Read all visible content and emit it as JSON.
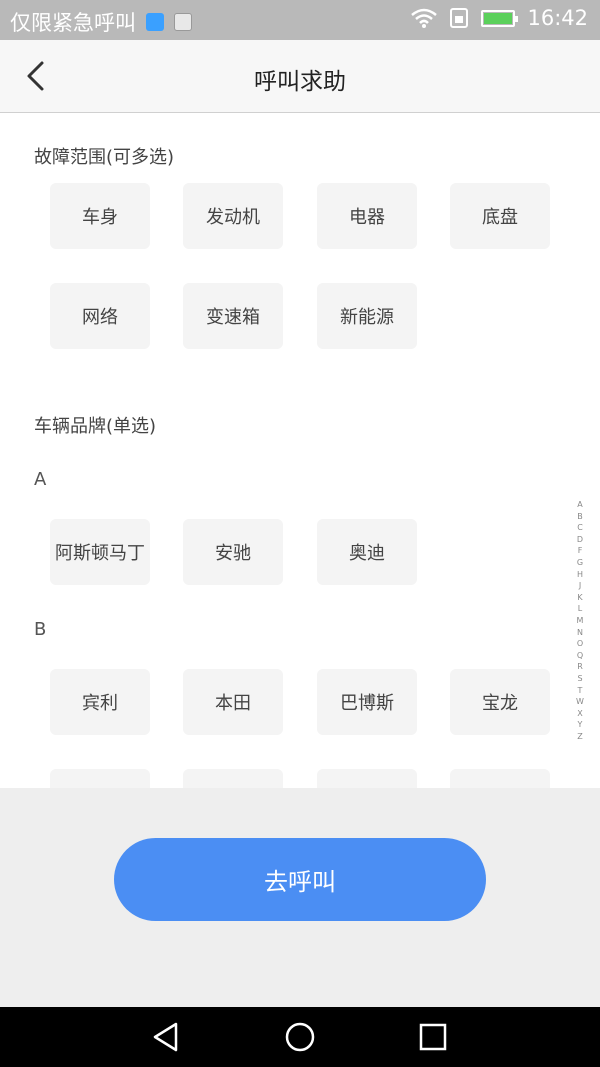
{
  "status_bar": {
    "carrier": "仅限紧急呼叫",
    "time": "16:42",
    "icons": [
      "usb-icon",
      "image-icon",
      "wifi-icon",
      "sim-icon",
      "battery-charging-icon"
    ]
  },
  "header": {
    "title": "呼叫求助",
    "back_icon": "chevron-left-icon"
  },
  "fault_section": {
    "title": "故障范围(可多选)",
    "options": [
      "车身",
      "发动机",
      "电器",
      "底盘",
      "网络",
      "变速箱",
      "新能源"
    ]
  },
  "brand_section": {
    "title": "车辆品牌(单选)",
    "groups": [
      {
        "letter": "A",
        "brands": [
          "阿斯顿马丁",
          "安驰",
          "奥迪"
        ]
      },
      {
        "letter": "B",
        "brands": [
          "宾利",
          "本田",
          "巴博斯",
          "宝龙"
        ]
      }
    ]
  },
  "index_letters": [
    "A",
    "B",
    "C",
    "D",
    "F",
    "G",
    "H",
    "J",
    "K",
    "L",
    "M",
    "N",
    "O",
    "Q",
    "R",
    "S",
    "T",
    "W",
    "X",
    "Y",
    "Z"
  ],
  "call_button": {
    "label": "去呼叫"
  },
  "nav_bar": {
    "icons": [
      "back-triangle-icon",
      "home-circle-icon",
      "recents-square-icon"
    ]
  },
  "colors": {
    "accent": "#4b8ef3",
    "chip_bg": "#f4f4f4",
    "panel_bg": "#eeeeee"
  }
}
